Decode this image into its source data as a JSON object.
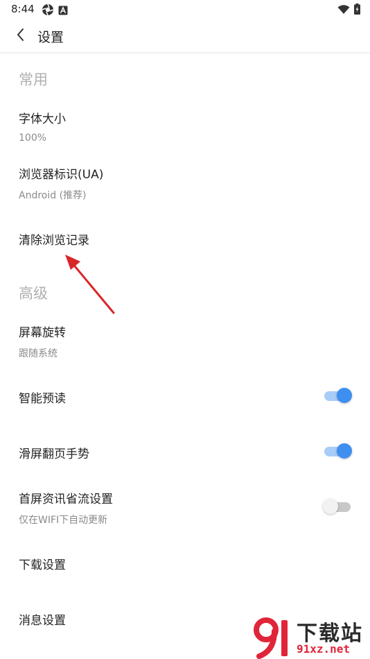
{
  "status_bar": {
    "time": "8:44",
    "left_icons": [
      "aperture-icon",
      "a-box-icon"
    ],
    "right_icons": [
      "wifi-icon",
      "battery-charging-icon"
    ]
  },
  "app_bar": {
    "title": "设置",
    "back_icon": "chevron-left-icon"
  },
  "sections": {
    "common": {
      "header": "常用",
      "font_size": {
        "title": "字体大小",
        "value": "100%"
      },
      "user_agent": {
        "title": "浏览器标识(UA)",
        "value": "Android (推荐)"
      },
      "clear_history": {
        "title": "清除浏览记录"
      }
    },
    "advanced": {
      "header": "高级",
      "screen_rotation": {
        "title": "屏幕旋转",
        "value": "跟随系统"
      },
      "smart_preload": {
        "title": "智能预读",
        "enabled": true
      },
      "swipe_gesture": {
        "title": "滑屏翻页手势",
        "enabled": true
      },
      "data_saving": {
        "title": "首屏资讯省流设置",
        "value": "仅在WIFI下自动更新",
        "enabled": false
      },
      "download_settings": {
        "title": "下载设置"
      },
      "message_settings": {
        "title": "消息设置"
      }
    }
  },
  "watermark": {
    "top": "下载站",
    "bottom": "91xz.net"
  },
  "colors": {
    "accent": "#3f8ff0",
    "accent_track": "#a9cdf7",
    "annotation_arrow": "#d9262a",
    "section_header": "#b0b0b0"
  }
}
